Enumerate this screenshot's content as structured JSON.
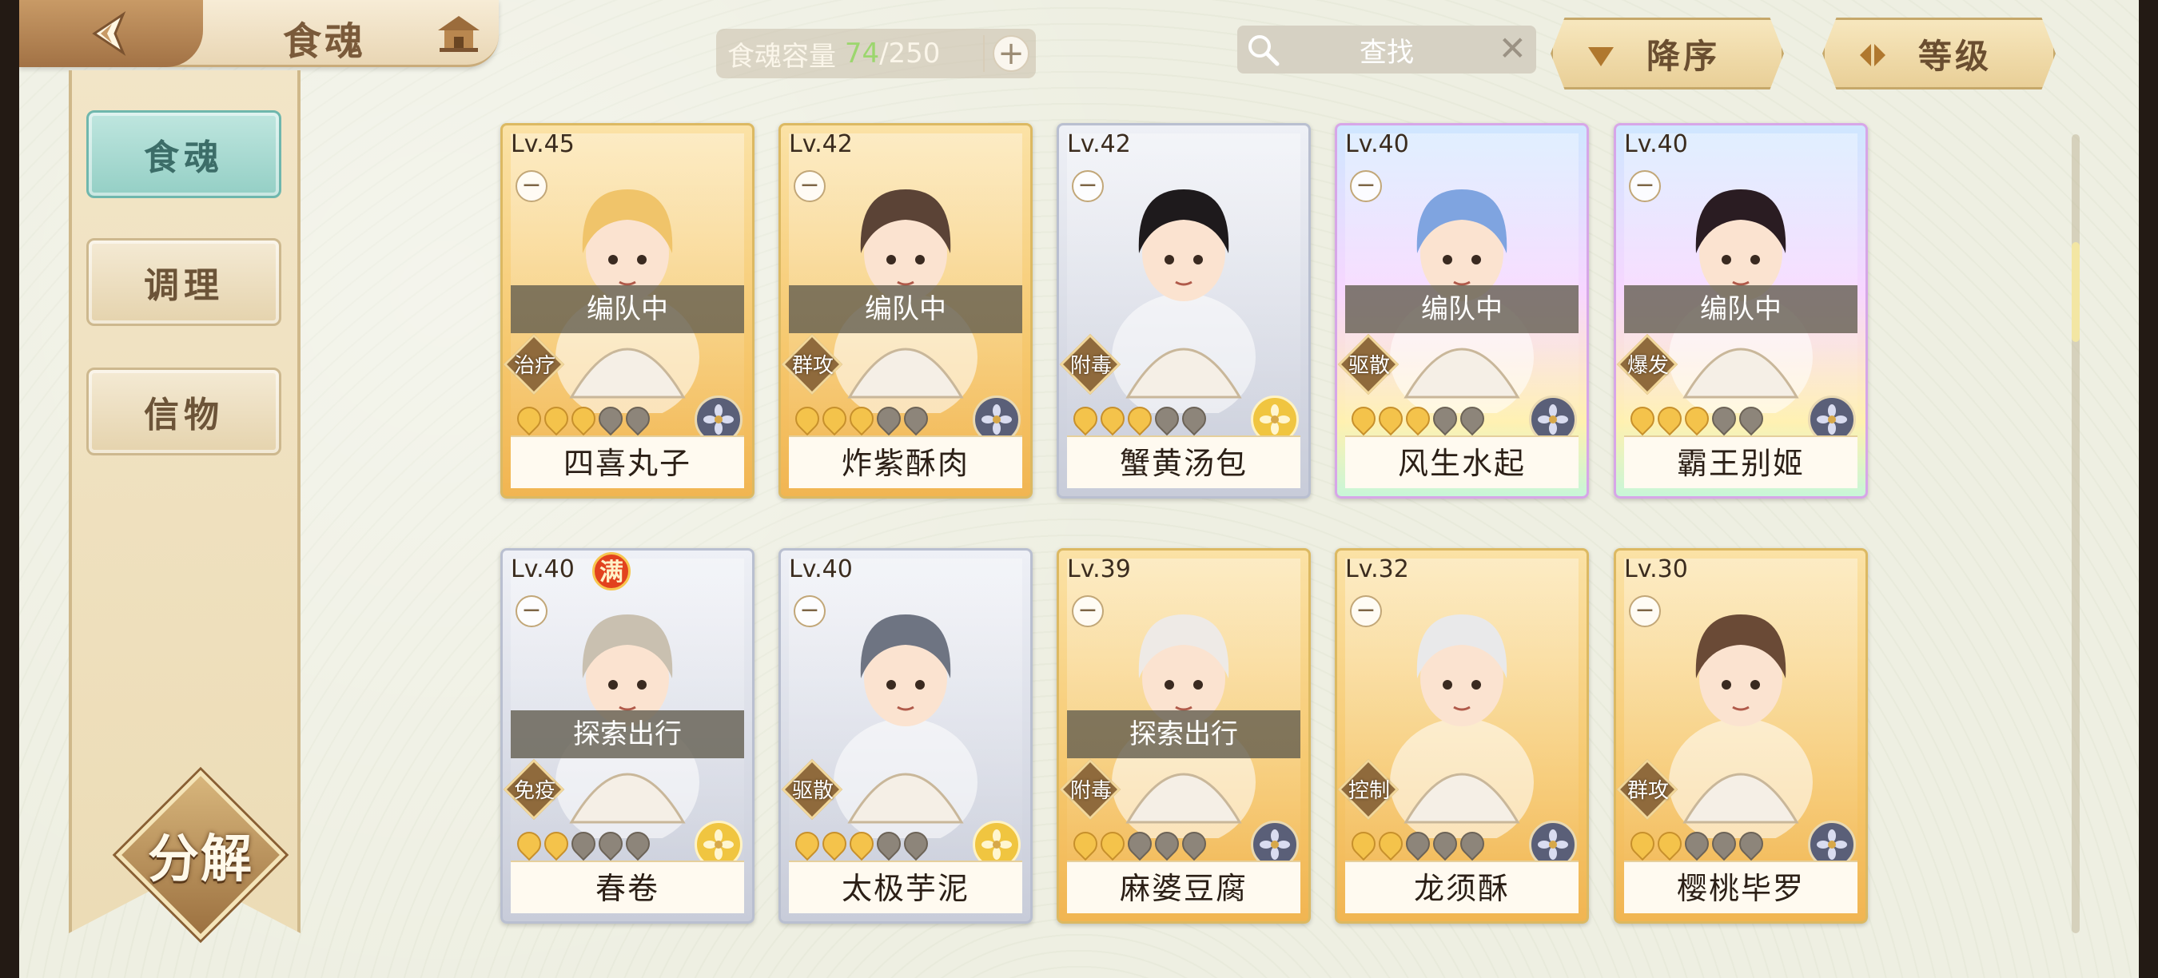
{
  "header": {
    "title": "食魂"
  },
  "capacity": {
    "label": "食魂容量",
    "current": "74",
    "total": "/250"
  },
  "search": {
    "label": "查找"
  },
  "sort": {
    "order_label": "降序",
    "key_label": "等级"
  },
  "sidebar": {
    "items": [
      {
        "label": "食魂",
        "active": true
      },
      {
        "label": "调理",
        "active": false
      },
      {
        "label": "信物",
        "active": false
      }
    ],
    "decompose_label": "分解"
  },
  "cards": [
    {
      "lv": "Lv.45",
      "status": "编队中",
      "role": "治疗",
      "name": "四喜丸子",
      "stars": 3,
      "frame": "gold",
      "element": "blue",
      "full": ""
    },
    {
      "lv": "Lv.42",
      "status": "编队中",
      "role": "群攻",
      "name": "炸紫酥肉",
      "stars": 3,
      "frame": "gold",
      "element": "blue",
      "full": ""
    },
    {
      "lv": "Lv.42",
      "status": "",
      "role": "附毒",
      "name": "蟹黄汤包",
      "stars": 3,
      "frame": "silver",
      "element": "gold",
      "full": ""
    },
    {
      "lv": "Lv.40",
      "status": "编队中",
      "role": "驱散",
      "name": "风生水起",
      "stars": 3,
      "frame": "rainbow",
      "element": "blue",
      "full": ""
    },
    {
      "lv": "Lv.40",
      "status": "编队中",
      "role": "爆发",
      "name": "霸王别姬",
      "stars": 3,
      "frame": "rainbow",
      "element": "blue",
      "full": ""
    },
    {
      "lv": "Lv.40",
      "status": "探索出行",
      "role": "免疫",
      "name": "春卷",
      "stars": 2,
      "frame": "silver",
      "element": "gold",
      "full": "满"
    },
    {
      "lv": "Lv.40",
      "status": "",
      "role": "驱散",
      "name": "太极芋泥",
      "stars": 3,
      "frame": "silver",
      "element": "gold",
      "full": ""
    },
    {
      "lv": "Lv.39",
      "status": "探索出行",
      "role": "附毒",
      "name": "麻婆豆腐",
      "stars": 2,
      "frame": "gold",
      "element": "blue",
      "full": ""
    },
    {
      "lv": "Lv.32",
      "status": "",
      "role": "控制",
      "name": "龙须酥",
      "stars": 2,
      "frame": "gold",
      "element": "blue",
      "full": ""
    },
    {
      "lv": "Lv.30",
      "status": "",
      "role": "群攻",
      "name": "樱桃毕罗",
      "stars": 2,
      "frame": "gold",
      "element": "blue",
      "full": ""
    }
  ],
  "colors": {
    "accent_teal": "#94cfc5",
    "frame_gold": "#dcb962",
    "capacity_current": "#9cd66e"
  }
}
